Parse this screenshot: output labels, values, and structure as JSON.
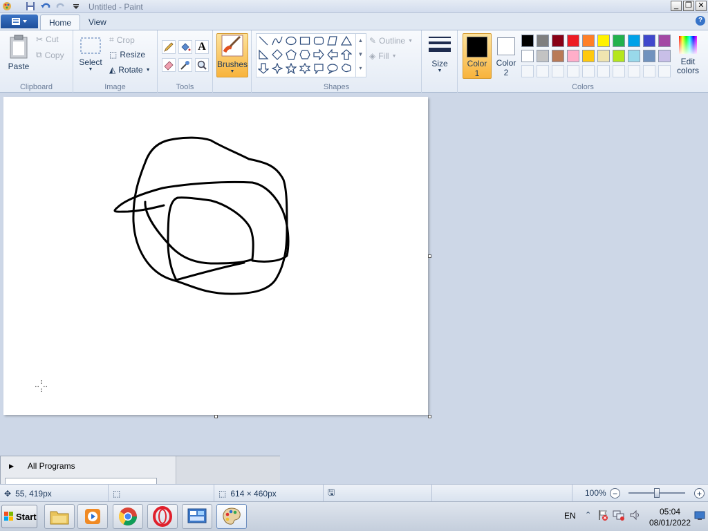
{
  "window": {
    "title": "Untitled - Paint",
    "controls": [
      "_",
      "❐",
      "✕"
    ]
  },
  "tabs": {
    "home": "Home",
    "view": "View"
  },
  "clipboard": {
    "label": "Clipboard",
    "paste": "Paste",
    "cut": "Cut",
    "copy": "Copy"
  },
  "image": {
    "label": "Image",
    "select": "Select",
    "crop": "Crop",
    "resize": "Resize",
    "rotate": "Rotate"
  },
  "tools": {
    "label": "Tools"
  },
  "brushes": {
    "label": "Brushes"
  },
  "shapes": {
    "label": "Shapes",
    "outline": "Outline",
    "fill": "Fill"
  },
  "size": {
    "label": "Size"
  },
  "colors": {
    "label": "Colors",
    "color1_line1": "Color",
    "color1_line2": "1",
    "color2_line1": "Color",
    "color2_line2": "2",
    "edit_line1": "Edit",
    "edit_line2": "colors",
    "color1_value": "#000000",
    "color2_value": "#ffffff",
    "palette_row1": [
      "#000000",
      "#7f7f7f",
      "#880015",
      "#ed1c24",
      "#ff7f27",
      "#fff200",
      "#22b14c",
      "#00a2e8",
      "#3f48cc",
      "#a349a4"
    ],
    "palette_row2": [
      "#ffffff",
      "#c3c3c3",
      "#b97a57",
      "#ffaec9",
      "#ffc90e",
      "#efe4b0",
      "#b5e61d",
      "#99d9ea",
      "#7092be",
      "#c8bfe7"
    ]
  },
  "start_menu": {
    "all_programs": "All Programs"
  },
  "status": {
    "cursor_pos": "55, 419px",
    "canvas_size": "614 × 460px",
    "zoom": "100%"
  },
  "taskbar": {
    "start": "Start",
    "lang": "EN",
    "time": "05:04",
    "date": "08/01/2022"
  }
}
